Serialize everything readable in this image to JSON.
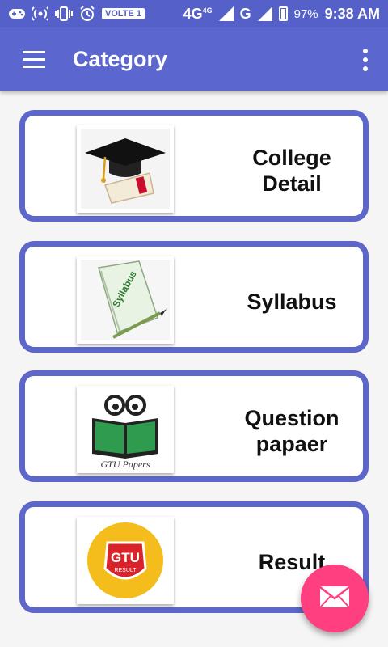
{
  "status_bar": {
    "network_type": "4G",
    "network_super": "4G",
    "volte": "VOLTE 1",
    "second_network": "G",
    "battery": "97%",
    "time": "9:38 AM"
  },
  "app_bar": {
    "title": "Category"
  },
  "categories": [
    {
      "label": "College\nDetail",
      "icon": "graduation-cap-icon"
    },
    {
      "label": "Syllabus",
      "icon": "syllabus-notebook-icon"
    },
    {
      "label": "Question\npapaer",
      "icon": "gtu-papers-icon"
    },
    {
      "label": "Result",
      "icon": "gtu-result-badge-icon"
    }
  ],
  "gtu_papers_caption": "GTU Papers",
  "gtu_result_text": "GTU",
  "gtu_result_sub": "RESULT",
  "syllabus_text": "Syllabus",
  "colors": {
    "primary": "#5b67cf",
    "status_bar": "#5561c9",
    "card_border": "#5c66cb",
    "fab": "#ff3f80"
  }
}
